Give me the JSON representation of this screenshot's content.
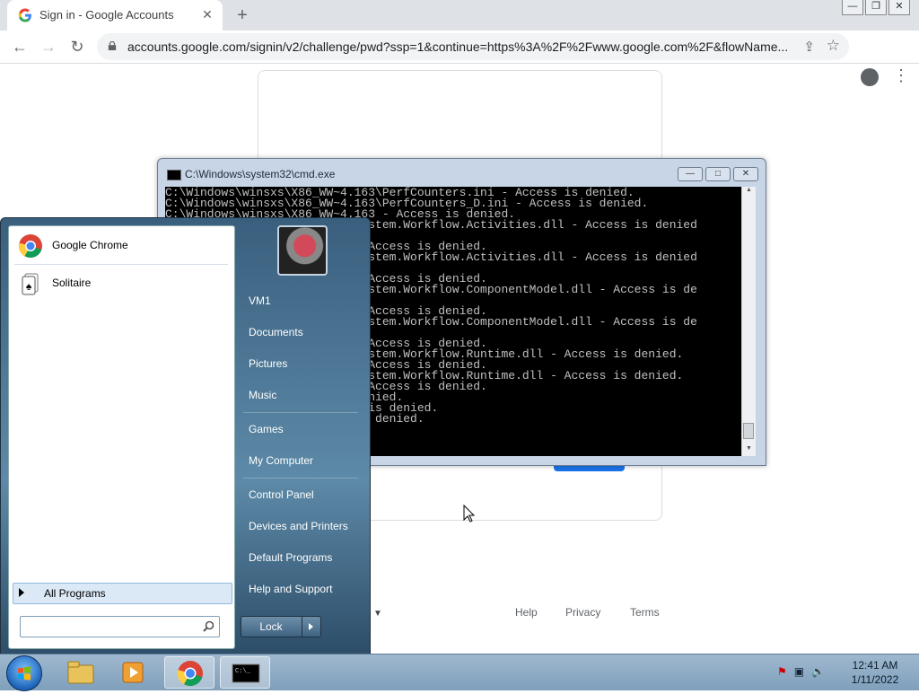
{
  "browser": {
    "tab_title": "Sign in - Google Accounts",
    "new_tab_symbol": "+",
    "url": "accounts.google.com/signin/v2/challenge/pwd?ssp=1&continue=https%3A%2F%2Fwww.google.com%2F&flowName...",
    "window_buttons": [
      "—",
      "❐",
      "✕"
    ]
  },
  "page": {
    "footer_links": [
      "Help",
      "Privacy",
      "Terms"
    ]
  },
  "cmd": {
    "title": "C:\\Windows\\system32\\cmd.exe",
    "window_buttons": [
      "—",
      "□",
      "✕"
    ],
    "lines": [
      "C:\\Windows\\winsxs\\X86_WW~4.163\\PerfCounters.ini - Access is denied.",
      "C:\\Windows\\winsxs\\X86_WW~4.163\\PerfCounters_D.ini - Access is denied.",
      "C:\\Windows\\winsxs\\X86_WW~4.163 - Access is denied.",
      "                        75\\System.Workflow.Activities.dll - Access is denied",
      "",
      "                        75 - Access is denied.",
      "                        43\\System.Workflow.Activities.dll - Access is denied",
      "",
      "                        43 - Access is denied.",
      "                        75\\System.Workflow.ComponentModel.dll - Access is de",
      "",
      "                        75 - Access is denied.",
      "                        43\\System.Workflow.ComponentModel.dll - Access is de",
      "",
      "                        43 - Access is denied.",
      "                        75\\System.Workflow.Runtime.dll - Access is denied.",
      "                        75 - Access is denied.",
      "                        43\\System.Workflow.Runtime.dll - Access is denied.",
      "                        43 - Access is denied.",
      "                         s denied.",
      "                        cess is denied.",
      "                         s is denied.",
      "                         d."
    ]
  },
  "start_menu": {
    "pinned": [
      {
        "label": "Google Chrome",
        "icon": "chrome-icon"
      },
      {
        "label": "Solitaire",
        "icon": "solitaire-icon"
      }
    ],
    "all_programs": "All Programs",
    "right_links": [
      "VM1",
      "Documents",
      "Pictures",
      "Music",
      "Games",
      "My Computer",
      "Control Panel",
      "Devices and Printers",
      "Default Programs",
      "Help and Support"
    ],
    "lock_label": "Lock"
  },
  "taskbar": {
    "items": [
      "explorer-icon",
      "media-player-icon",
      "chrome-icon",
      "cmd-icon"
    ],
    "time": "12:41 AM",
    "date": "1/11/2022"
  }
}
